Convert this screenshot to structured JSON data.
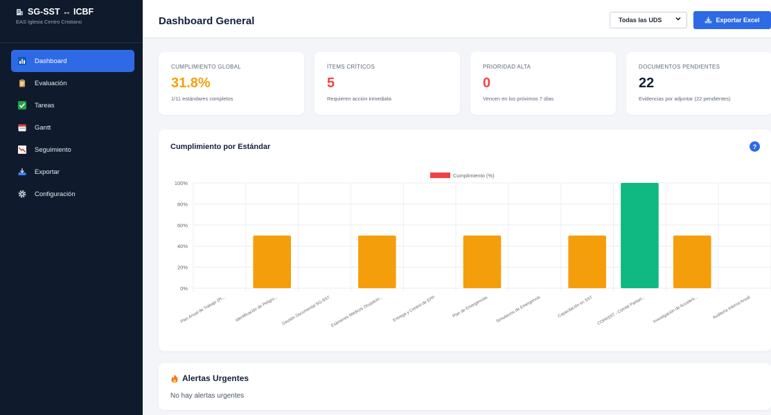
{
  "brand": {
    "title": "SG-SST ↔ ICBF",
    "subtitle": "EAS Iglesia Centro Cristiano"
  },
  "sidebar": {
    "items": [
      {
        "label": "Dashboard",
        "icon": "bar-chart-icon",
        "active": true
      },
      {
        "label": "Evaluación",
        "icon": "clipboard-icon",
        "active": false
      },
      {
        "label": "Tareas",
        "icon": "checkbox-icon",
        "active": false
      },
      {
        "label": "Gantt",
        "icon": "calendar-icon",
        "active": false
      },
      {
        "label": "Seguimiento",
        "icon": "trend-icon",
        "active": false
      },
      {
        "label": "Exportar",
        "icon": "export-icon",
        "active": false
      },
      {
        "label": "Configuración",
        "icon": "gear-icon",
        "active": false
      }
    ]
  },
  "header": {
    "title": "Dashboard General",
    "filter_value": "Todas las UDS",
    "export_label": "Exportar Excel"
  },
  "kpis": [
    {
      "label": "CUMPLIMIENTO GLOBAL",
      "value": "31.8%",
      "sub": "1/11 estándares completos",
      "color": "#f59e0b"
    },
    {
      "label": "ÍTEMS CRÍTICOS",
      "value": "5",
      "sub": "Requieren acción inmediata",
      "color": "#ef4444"
    },
    {
      "label": "PRIORIDAD ALTA",
      "value": "0",
      "sub": "Vencen en los próximos 7 días",
      "color": "#ef4444"
    },
    {
      "label": "DOCUMENTOS PENDIENTES",
      "value": "22",
      "sub": "Evidencias por adjuntar (22 pendientes)",
      "color": "#13203a"
    }
  ],
  "chart_panel": {
    "title": "Cumplimiento por Estándar",
    "help": "?"
  },
  "chart_data": {
    "type": "bar",
    "legend": "Cumplimiento (%)",
    "legend_color": "#ef4444",
    "categories": [
      "Plan Anual de Trabajo (Pl...",
      "Identificación de Peligro...",
      "Gestión Documental SG-SST",
      "Exámenes Médicos Ocupacio...",
      "Entrega y Control de EPP",
      "Plan de Emergencias",
      "Simulacros de Emergencia",
      "Capacitación en SST",
      "COPASST - Comité Paritari...",
      "Investigación de Accident...",
      "Auditoría Interna Anual"
    ],
    "values": [
      0,
      50,
      0,
      50,
      0,
      50,
      0,
      50,
      100,
      50,
      0
    ],
    "colors": [
      "#f59e0b",
      "#f59e0b",
      "#f59e0b",
      "#f59e0b",
      "#f59e0b",
      "#f59e0b",
      "#f59e0b",
      "#f59e0b",
      "#10b981",
      "#f59e0b",
      "#f59e0b"
    ],
    "ylim": [
      0,
      100
    ],
    "yticks": [
      "0%",
      "20%",
      "40%",
      "60%",
      "80%",
      "100%"
    ],
    "grid": true,
    "legend_position": "top"
  },
  "alerts": {
    "icon": "fire-icon",
    "title": "Alertas Urgentes",
    "empty": "No hay alertas urgentes"
  }
}
